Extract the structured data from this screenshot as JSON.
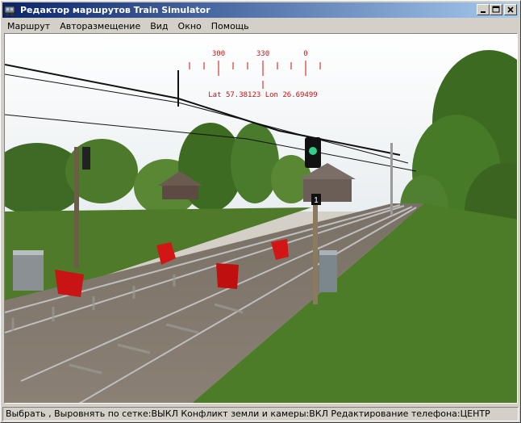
{
  "window": {
    "title": "Редактор маршрутов Train Simulator",
    "controls": [
      "minimize",
      "maximize",
      "close"
    ]
  },
  "menu": [
    {
      "label": "Маршрут"
    },
    {
      "label": "Авторазмещение"
    },
    {
      "label": "Вид"
    },
    {
      "label": "Окно"
    },
    {
      "label": "Помощь"
    }
  ],
  "compass": {
    "headings": [
      "300",
      "330",
      "0"
    ],
    "position_text": "Lat 57.38123 Lon 26.69499"
  },
  "signal": {
    "plate_number": "1"
  },
  "statusbar": {
    "text": "Выбрать , Выровнять по сетке:ВЫКЛ Конфликт земли и камеры:ВКЛ Редактирование телефона:ЦЕНТР"
  },
  "colors": {
    "title_active_start": "#0a246a",
    "title_active_end": "#a6caf0",
    "sky": "#f2f5f6",
    "grass": "#4d7a2a",
    "marker_red": "#c81414",
    "compass_red": "#cc1111"
  }
}
